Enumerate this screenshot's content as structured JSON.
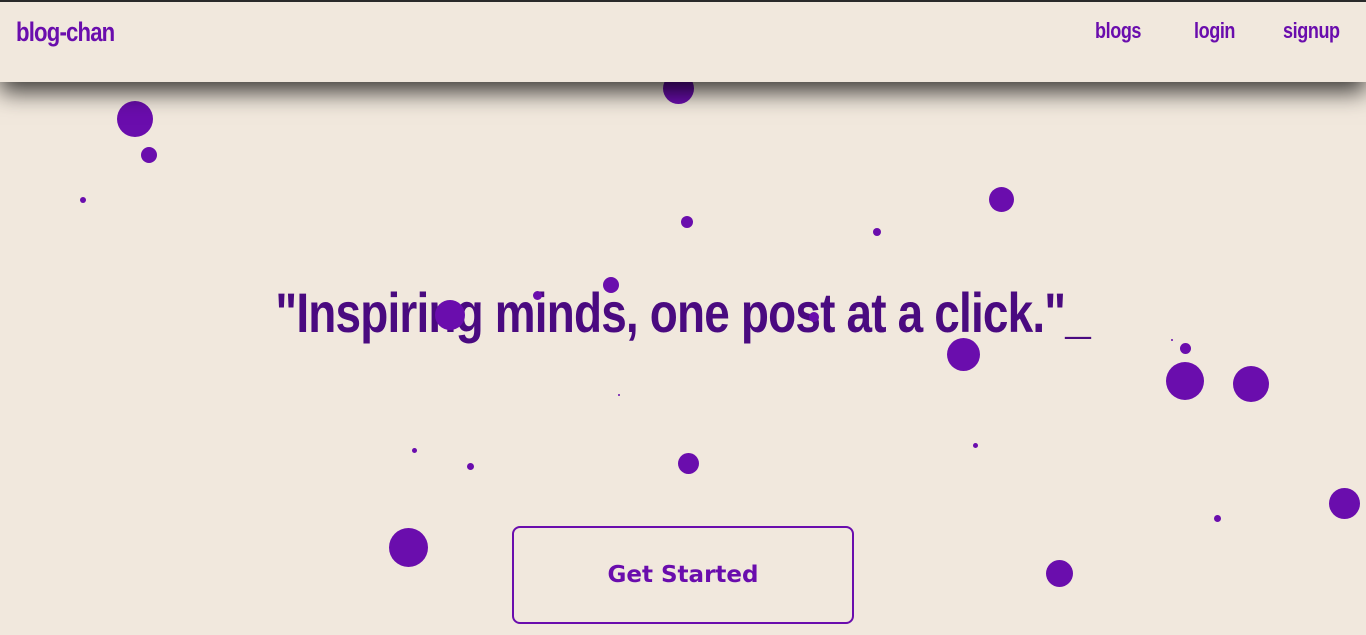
{
  "navbar": {
    "brand": "blog-chan",
    "links": [
      {
        "label": "blogs"
      },
      {
        "label": "login"
      },
      {
        "label": "signup"
      }
    ]
  },
  "hero": {
    "quote": "\"Inspiring minds, one post at a click.\"",
    "cursor": "_",
    "cta_label": "Get Started"
  },
  "colors": {
    "background": "#f1e8dd",
    "accent": "#6a0dad",
    "headline": "#4a0a80"
  }
}
